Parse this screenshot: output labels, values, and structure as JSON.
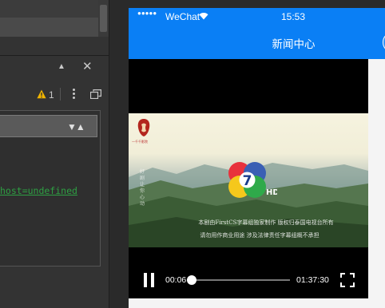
{
  "devtools": {
    "warning_count": "1",
    "console_line": "host=undefined"
  },
  "phone": {
    "status": {
      "signal_dots": "●●●●●",
      "carrier": "WeChat",
      "time": "15:53"
    },
    "navbar": {
      "title": "新闻中心"
    },
    "video": {
      "corner_logo_text": "一千千影院",
      "side_text": "好剧 让你心动",
      "subtitle_line1": "本剧由FirstCS字幕组独家制作  版权归泰国电视台所有",
      "subtitle_line2": "请勿用作商业用途  涉及法律责任字幕组概不承担",
      "current_time": "00:06",
      "total_time": "01:37:30",
      "progress": 0.0
    }
  },
  "colors": {
    "nav_blue": "#0a7ff5",
    "console_green": "#2ea043",
    "warning_yellow": "#f0b400"
  }
}
